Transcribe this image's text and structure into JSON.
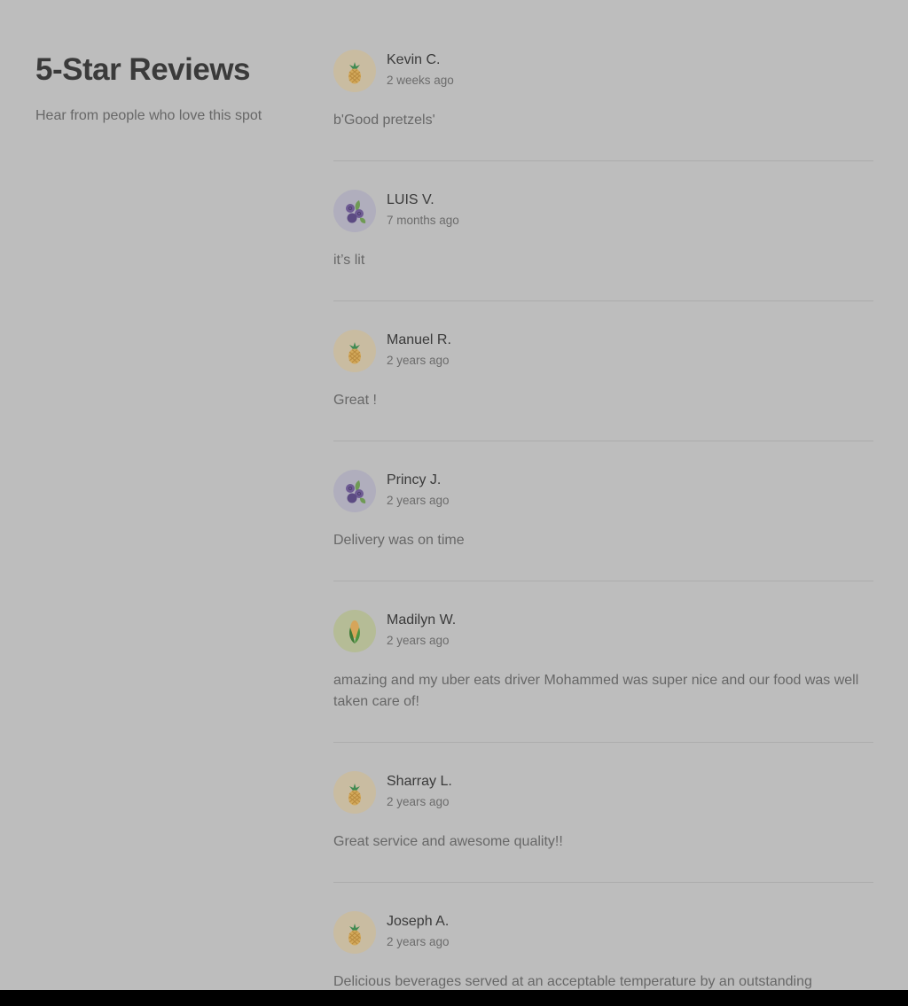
{
  "section": {
    "title": "5-Star Reviews",
    "subtitle": "Hear from people who love this spot"
  },
  "reviews": [
    {
      "name": "Kevin C.",
      "date": "2 weeks ago",
      "text": "b'Good pretzels'",
      "avatar": "pineapple-icon"
    },
    {
      "name": "LUIS V.",
      "date": "7 months ago",
      "text": "it’s lit",
      "avatar": "blueberry-icon"
    },
    {
      "name": "Manuel R.",
      "date": "2 years ago",
      "text": "Great !",
      "avatar": "pineapple-icon"
    },
    {
      "name": "Princy J.",
      "date": "2 years ago",
      "text": "Delivery was on time",
      "avatar": "blueberry-icon"
    },
    {
      "name": "Madilyn W.",
      "date": "2 years ago",
      "text": "amazing and my uber eats driver Mohammed was super nice and our food was well taken care of!",
      "avatar": "corn-icon"
    },
    {
      "name": "Sharray L.",
      "date": "2 years ago",
      "text": "Great service and awesome quality!!",
      "avatar": "pineapple-icon"
    },
    {
      "name": "Joseph A.",
      "date": "2 years ago",
      "text": "Delicious beverages served at an acceptable temperature by an outstanding",
      "avatar": "pineapple-icon"
    }
  ],
  "colors": {
    "page_background": "#bdbdbd",
    "bottom_bar": "#000000",
    "heading_text": "#3a3a3a",
    "body_text": "#676767"
  }
}
